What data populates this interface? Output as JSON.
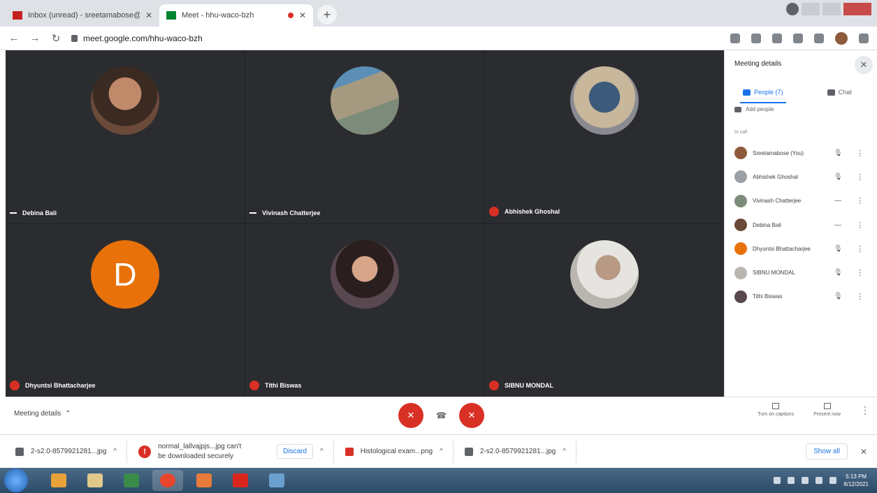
{
  "browser": {
    "tabs": [
      {
        "title": "Inbox (unread) - sreetamabose@gmail...",
        "favicon_color": "#c5221f",
        "active": false
      },
      {
        "title": "Meet - hhu-waco-bzh",
        "favicon_color": "#00832d",
        "active": true,
        "recording": true
      }
    ],
    "new_tab_label": "+",
    "url": "meet.google.com/hhu-waco-bzh"
  },
  "meet": {
    "tiles": [
      {
        "name": "Debina Bali",
        "indicator": "speaking",
        "photo": "#6b4a3a"
      },
      {
        "name": "Vivinash Chatterjee",
        "indicator": "speaking",
        "photo": "#7d8b7a"
      },
      {
        "name": "Abhishek Ghoshal",
        "indicator": "muted",
        "photo": "#8a8a92"
      },
      {
        "name": "Dhyuntsi Bhattacharjee",
        "indicator": "muted",
        "letter": "D"
      },
      {
        "name": "Tithi Biswas",
        "indicator": "muted",
        "photo": "#5a4850"
      },
      {
        "name": "SIBNU MONDAL",
        "indicator": "muted",
        "photo": "#b9b6b0"
      }
    ],
    "panel": {
      "title": "Meeting details",
      "close_label": "✕",
      "tab_people": "People (7)",
      "tab_chat": "Chat",
      "add_people": "Add people",
      "section_label": "In call",
      "participants": [
        {
          "name": "Sreetamabose (You)",
          "mic": "🎙",
          "avatar": "#8d5a3b"
        },
        {
          "name": "Abhishek Ghoshal",
          "mic": "🎙",
          "avatar": "#9aa0a6"
        },
        {
          "name": "Vivinash Chatterjee",
          "mic": "—",
          "avatar": "#7d8b7a"
        },
        {
          "name": "Debina Bali",
          "mic": "—",
          "avatar": "#6b4a3a"
        },
        {
          "name": "Dhyuntsi Bhattacharjee",
          "mic": "🎙",
          "avatar": "#e8710a"
        },
        {
          "name": "SIBNU MONDAL",
          "mic": "🎙",
          "avatar": "#b9b6b0"
        },
        {
          "name": "Tithi Biswas",
          "mic": "🎙",
          "avatar": "#5a4850"
        }
      ],
      "more_icon": "⋮"
    },
    "bottom": {
      "meeting_details": "Meeting details",
      "meeting_details_chevron": "⌃",
      "mic_off": "✕",
      "hangup": "☎",
      "cam_off": "✕",
      "turn_on_captions": "Turn on captions",
      "present_now": "Present now",
      "more": "⋮"
    }
  },
  "downloads": {
    "items": [
      {
        "name": "2-s2.0-8579921281...jpg",
        "chevron": "^"
      },
      {
        "name": "normal_lallvajpjs...jpg can't be downloaded securely",
        "line1": "normal_lallvajpjs...jpg can't",
        "line2": "be downloaded securely",
        "discard": "Discard",
        "chevron": "^",
        "warning": "!"
      },
      {
        "name": "Histological exam...png",
        "chevron": "^"
      },
      {
        "name": "2-s2.0-8579921281...jpg",
        "chevron": "^"
      }
    ],
    "show_all": "Show all",
    "close": "✕"
  },
  "taskbar": {
    "apps": [
      "#e8a23a",
      "#e0c98a",
      "#3a8a4a",
      "#e9442c",
      "#e87a3a",
      "#d9261c",
      "#6aa0d0"
    ],
    "time": "5:13 PM",
    "date": "8/12/2021"
  }
}
